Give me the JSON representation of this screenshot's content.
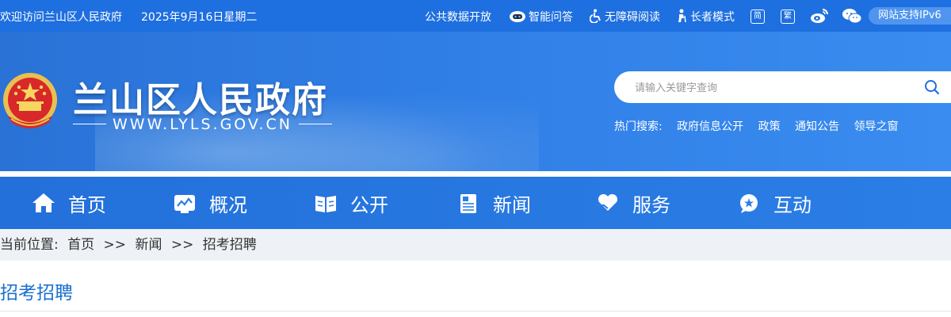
{
  "topbar": {
    "welcome": "欢迎访问兰山区人民政府",
    "date": "2025年9月16日星期二",
    "links": {
      "open_data": "公共数据开放",
      "smart_qa": "智能问答",
      "accessible": "无障碍阅读",
      "elder_mode": "长者模式"
    },
    "simplified": "简",
    "traditional": "繁",
    "ipv6": "网站支持IPv6"
  },
  "header": {
    "site_title": "兰山区人民政府",
    "site_url": "WWW.LYLS.GOV.CN",
    "search": {
      "placeholder": "请输入关键字查询"
    },
    "hot_label": "热门搜索:",
    "hot_terms": [
      "政府信息公开",
      "政策",
      "通知公告",
      "领导之窗"
    ]
  },
  "nav": {
    "items": [
      {
        "label": "首页",
        "icon": "home-icon"
      },
      {
        "label": "概况",
        "icon": "overview-icon"
      },
      {
        "label": "公开",
        "icon": "book-icon"
      },
      {
        "label": "新闻",
        "icon": "news-icon"
      },
      {
        "label": "服务",
        "icon": "heart-hand-icon"
      },
      {
        "label": "互动",
        "icon": "chat-icon"
      }
    ]
  },
  "breadcrumb": {
    "prefix": "当前位置:",
    "items": [
      "首页",
      "新闻",
      "招考招聘"
    ],
    "separator": ">>"
  },
  "section": {
    "title": "招考招聘"
  },
  "colors": {
    "primary_blue": "#1e6fe0",
    "nav_blue": "#2b7ee6",
    "breadcrumb_bg": "#eef2f6",
    "title_blue": "#1a6fd0"
  }
}
